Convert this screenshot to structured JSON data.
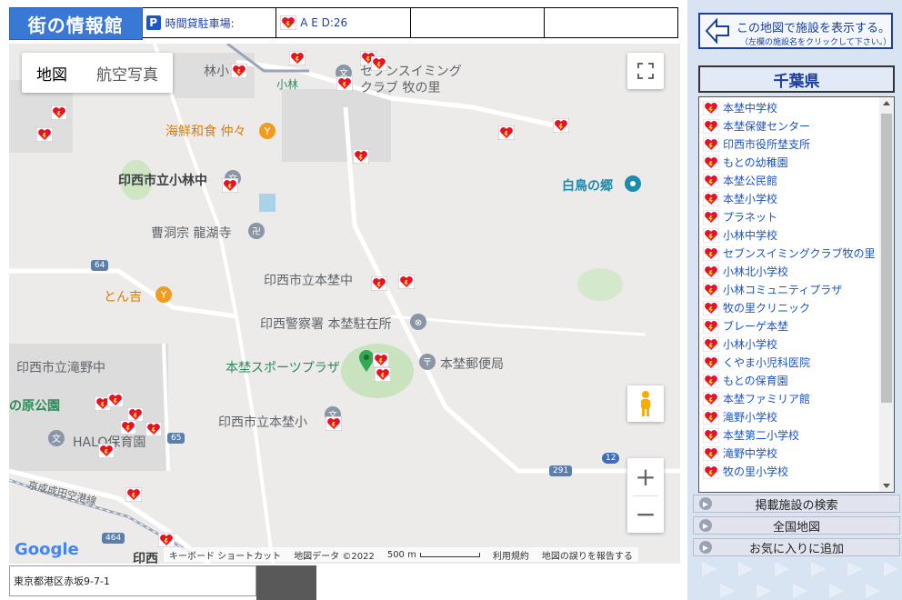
{
  "header": {
    "brand": "街の情報館",
    "parking_icon": "P",
    "parking_label": "時間貸駐車場:",
    "aed_label": "A E D:26"
  },
  "map": {
    "type_buttons": [
      "地図",
      "航空写真"
    ],
    "labels": {
      "kobayashi_sho": "林小",
      "seven_swim": "セブンスイミング",
      "seven_swim2": "クラブ 牧の里",
      "kobayashi_station": "小林",
      "kaisen": "海鮮和食 仲々",
      "kobayashi_chu": "印西市立小林中",
      "hakucho": "白鳥の郷",
      "sotoshu": "曹洞宗 龍湖寺",
      "route64": "64",
      "motono_chu": "印西市立本埜中",
      "tonkichi": "とん吉",
      "police": "印西警察署 本埜駐在所",
      "takino_chu": "印西市立滝野中",
      "sports_plaza": "本埜スポーツプラザ",
      "post_office": "本埜郵便局",
      "nohara_park": "の原公園",
      "motono_sho": "印西市立本埜小",
      "route65": "65",
      "halo": "HALO保育園",
      "route291": "291",
      "route12": "12",
      "keisei": "京成成田空港線",
      "route464": "464",
      "google": "Google",
      "inzai_partial": "印西"
    },
    "footer": {
      "shortcuts": "キーボード ショートカット",
      "mapdata": "地図データ ©2022",
      "scale": "500 m",
      "terms": "利用規約",
      "report": "地図の誤りを報告する"
    }
  },
  "address": "東京都港区赤坂9-7-1",
  "sidebar": {
    "show_button_main": "この地図で施設を表示する。",
    "show_button_sub": "（左欄の施設名をクリックして下さい。）",
    "prefecture": "千葉県",
    "facilities": [
      "本埜中学校",
      "本埜保健センター",
      "印西市役所埜支所",
      "もとの幼稚園",
      "本埜公民館",
      "本埜小学校",
      "プラネット",
      "小林中学校",
      "セブンスイミングクラブ牧の里",
      "小林北小学校",
      "小林コミュニティプラザ",
      "牧の里クリニック",
      "ブレーゲ本埜",
      "小林小学校",
      "くやま小児科医院",
      "もとの保育園",
      "本埜ファミリア館",
      "滝野小学校",
      "本埜第二小学校",
      "滝野中学校",
      "牧の里小学校"
    ],
    "menu": [
      "掲載施設の検索",
      "全国地図",
      "お気に入りに追加"
    ]
  },
  "colors": {
    "brand_bg": "#3a78d6",
    "link": "#1a55c4",
    "aed_red": "#e8112d"
  }
}
